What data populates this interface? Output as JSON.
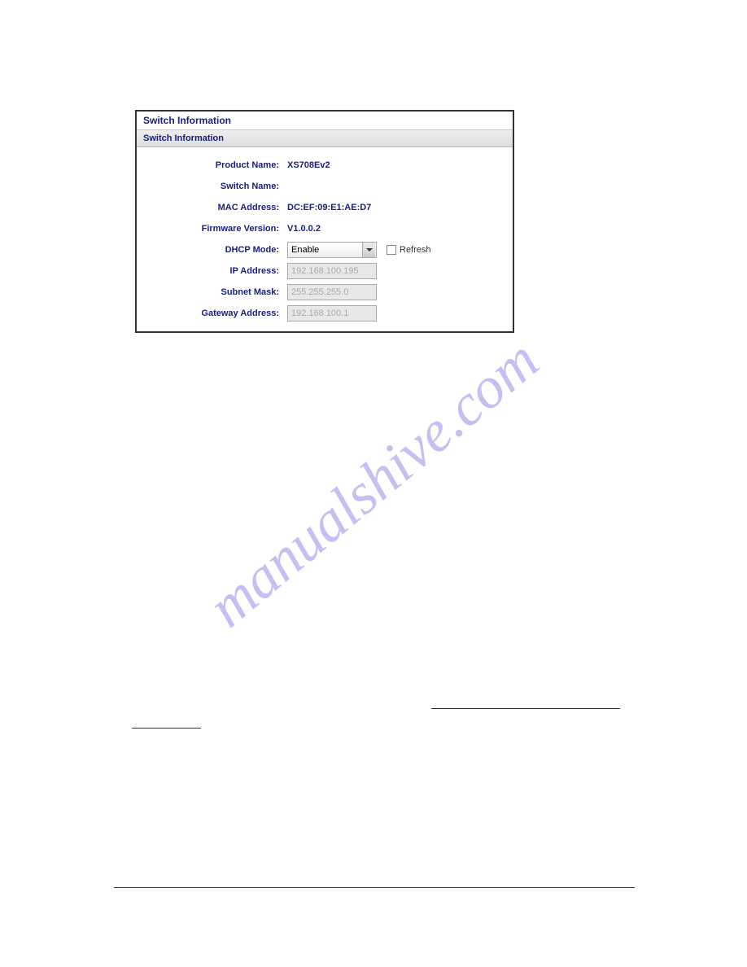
{
  "watermark": "manualshive.com",
  "panel": {
    "title": "Switch Information",
    "subtitle": "Switch Information",
    "fields": {
      "product_name": {
        "label": "Product Name:",
        "value": "XS708Ev2"
      },
      "switch_name": {
        "label": "Switch Name:",
        "value": ""
      },
      "mac_address": {
        "label": "MAC Address:",
        "value": "DC:EF:09:E1:AE:D7"
      },
      "firmware_version": {
        "label": "Firmware Version:",
        "value": "V1.0.0.2"
      },
      "dhcp_mode": {
        "label": "DHCP Mode:",
        "value": "Enable",
        "refresh_label": "Refresh"
      },
      "ip_address": {
        "label": "IP Address:",
        "value": "192.168.100.195"
      },
      "subnet_mask": {
        "label": "Subnet Mask:",
        "value": "255.255.255.0"
      },
      "gateway_address": {
        "label": "Gateway Address:",
        "value": "192.168.100.1"
      }
    }
  }
}
